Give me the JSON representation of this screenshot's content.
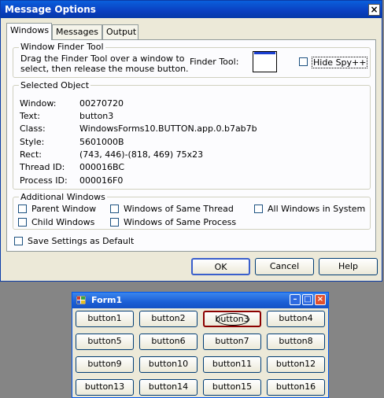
{
  "dialog": {
    "title": "Message Options",
    "close_glyph": "×",
    "tabs": [
      {
        "label": "Windows",
        "active": true
      },
      {
        "label": "Messages",
        "active": false
      },
      {
        "label": "Output",
        "active": false
      }
    ],
    "finder": {
      "group_label": "Window Finder Tool",
      "instructions_1": "Drag the Finder Tool over a window to",
      "instructions_2": "select, then release the mouse button.",
      "finder_label": "Finder Tool:",
      "hide_spy_label": "Hide Spy++",
      "hide_spy_checked": false
    },
    "selected": {
      "group_label": "Selected Object",
      "rows": [
        {
          "label": "Window:",
          "value": "00270720"
        },
        {
          "label": "Text:",
          "value": "button3"
        },
        {
          "label": "Class:",
          "value": "WindowsForms10.BUTTON.app.0.b7ab7b"
        },
        {
          "label": "Style:",
          "value": "5601000B"
        },
        {
          "label": "Rect:",
          "value": "(743, 446)-(818, 469) 75x23"
        },
        {
          "label": "Thread ID:",
          "value": "000016BC"
        },
        {
          "label": "Process ID:",
          "value": "000016F0"
        }
      ]
    },
    "additional": {
      "group_label": "Additional Windows",
      "parent_window": "Parent Window",
      "child_windows": "Child Windows",
      "same_thread": "Windows of Same Thread",
      "same_process": "Windows of Same Process",
      "all_windows": "All Windows in System"
    },
    "save_default": "Save Settings as Default",
    "buttons": {
      "ok": "OK",
      "cancel": "Cancel",
      "help": "Help"
    }
  },
  "form": {
    "title": "Form1",
    "buttons": [
      "button1",
      "button2",
      "button3",
      "button4",
      "button5",
      "button6",
      "button7",
      "button8",
      "button9",
      "button10",
      "button11",
      "button12",
      "button13",
      "button14",
      "button15",
      "button16"
    ],
    "highlighted": "button3"
  },
  "colors": {
    "title_bar": "#0a3fc0",
    "dialog_bg": "#ece9d8",
    "desktop_bg": "#858585",
    "highlight_border": "#8b0000"
  }
}
